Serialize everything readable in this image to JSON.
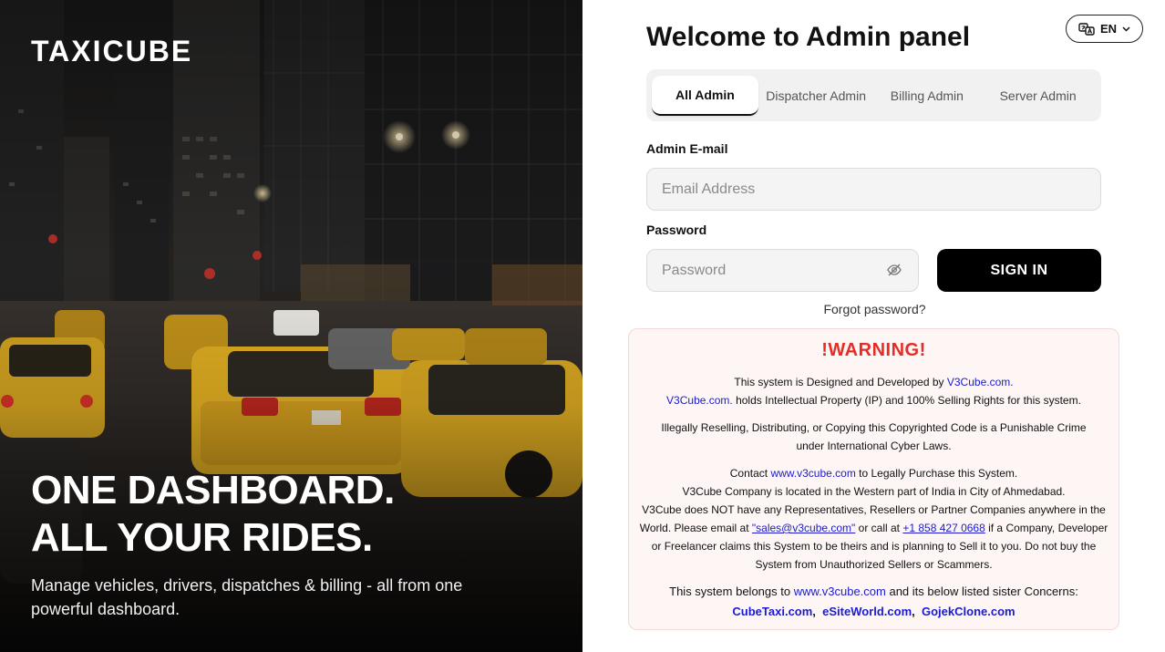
{
  "hero": {
    "brand": "TAXICUBE",
    "headline_line1": "ONE DASHBOARD.",
    "headline_line2": "ALL YOUR RIDES.",
    "subline": "Manage vehicles, drivers, dispatches & billing - all from one powerful dashboard."
  },
  "language": {
    "label": "EN",
    "icon": "translate-icon"
  },
  "title": "Welcome to Admin panel",
  "tabs": [
    {
      "label": "All Admin",
      "active": true
    },
    {
      "label": "Dispatcher Admin",
      "active": false
    },
    {
      "label": "Billing Admin",
      "active": false
    },
    {
      "label": "Server Admin",
      "active": false
    }
  ],
  "form": {
    "email_label": "Admin E-mail",
    "email_placeholder": "Email Address",
    "password_label": "Password",
    "password_placeholder": "Password",
    "signin_label": "SIGN IN",
    "forgot_label": "Forgot password?"
  },
  "warning": {
    "title": "!WARNING!",
    "p1_a": "This system is Designed and Developed by ",
    "p1_link1": "V3Cube.com.",
    "p1_link2": "V3Cube.com.",
    "p1_b": " holds Intellectual Property (IP) and 100% Selling Rights for this system.",
    "p2": "Illegally Reselling, Distributing, or Copying this Copyrighted Code is a Punishable Crime under International Cyber Laws.",
    "p3_a": "Contact ",
    "p3_link": "www.v3cube.com",
    "p3_b": " to Legally Purchase this System.",
    "p3_line2": "V3Cube Company is located in the Western part of India in City of Ahmedabad.",
    "p3_c": "V3Cube does NOT have any Representatives, Resellers or Partner Companies anywhere in the World. Please email at ",
    "p3_email": "\"sales@v3cube.com\"",
    "p3_d": " or call at ",
    "p3_phone": "+1 858 427 0668",
    "p3_e": " if a Company, Developer or Freelancer claims this System to be theirs and is planning to Sell it to you. Do not buy the System from Unauthorized Sellers or Scammers.",
    "p4_a": "This system belongs to ",
    "p4_link": "www.v3cube.com",
    "p4_b": " and its below listed sister Concerns:",
    "sisters": [
      "CubeTaxi.com",
      "eSiteWorld.com",
      "GojekClone.com"
    ]
  },
  "colors": {
    "warning_red": "#e52d27",
    "link_blue": "#1a1ad1",
    "button_black": "#000000",
    "taxi_yellow": "#e8b423"
  }
}
